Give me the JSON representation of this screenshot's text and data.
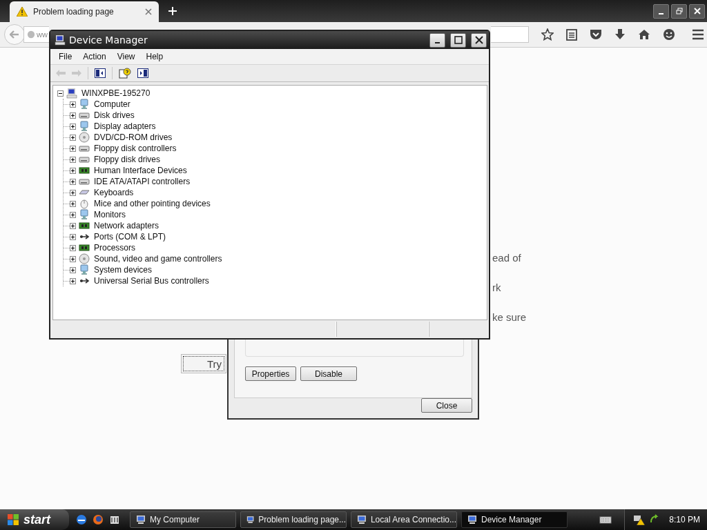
{
  "browser": {
    "tabs": [
      {
        "label": "Problem loading page",
        "selected": true
      }
    ],
    "url": "ww",
    "page_lines": [
      "ead of",
      "rk",
      "ke sure"
    ],
    "try_button": "Try"
  },
  "dialog": {
    "buttons": [
      "Properties",
      "Disable"
    ],
    "close_button": "Close"
  },
  "device_manager": {
    "title": "Device Manager",
    "menu": [
      "File",
      "Action",
      "View",
      "Help"
    ],
    "tree": {
      "label": "WINXPBE-195270",
      "expanded": true,
      "children": [
        {
          "label": "Computer",
          "expanded": false,
          "kind": "monitor"
        },
        {
          "label": "Disk drives",
          "expanded": false,
          "kind": "drive"
        },
        {
          "label": "Display adapters",
          "expanded": false,
          "kind": "monitor"
        },
        {
          "label": "DVD/CD-ROM drives",
          "expanded": false,
          "kind": "disc"
        },
        {
          "label": "Floppy disk controllers",
          "expanded": false,
          "kind": "drive"
        },
        {
          "label": "Floppy disk drives",
          "expanded": false,
          "kind": "drive"
        },
        {
          "label": "Human Interface Devices",
          "expanded": false,
          "kind": "board"
        },
        {
          "label": "IDE ATA/ATAPI controllers",
          "expanded": false,
          "kind": "drive"
        },
        {
          "label": "Keyboards",
          "expanded": false,
          "kind": "keyboard"
        },
        {
          "label": "Mice and other pointing devices",
          "expanded": false,
          "kind": "mouse"
        },
        {
          "label": "Monitors",
          "expanded": false,
          "kind": "monitor"
        },
        {
          "label": "Network adapters",
          "expanded": false,
          "kind": "board"
        },
        {
          "label": "Ports (COM & LPT)",
          "expanded": false,
          "kind": "plug"
        },
        {
          "label": "Processors",
          "expanded": false,
          "kind": "board"
        },
        {
          "label": "Sound, video and game controllers",
          "expanded": false,
          "kind": "disc"
        },
        {
          "label": "System devices",
          "expanded": false,
          "kind": "monitor"
        },
        {
          "label": "Universal Serial Bus controllers",
          "expanded": false,
          "kind": "plug"
        }
      ]
    }
  },
  "taskbar": {
    "start": "start",
    "tasks": [
      {
        "label": "My Computer",
        "selected": false
      },
      {
        "label": "Problem loading page...",
        "selected": false
      },
      {
        "label": "Local Area Connectio...",
        "selected": false
      },
      {
        "label": "Device Manager",
        "selected": true
      }
    ],
    "clock": "8:10 PM"
  }
}
